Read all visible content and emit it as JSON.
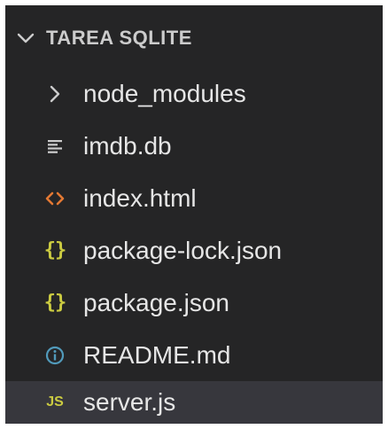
{
  "explorer": {
    "section_title": "TAREA SQLITE",
    "items": [
      {
        "label": "node_modules",
        "icon": "chevron-right-icon",
        "type": "folder",
        "collapsed": true
      },
      {
        "label": "imdb.db",
        "icon": "lines-icon",
        "type": "file"
      },
      {
        "label": "index.html",
        "icon": "html-icon",
        "type": "file"
      },
      {
        "label": "package-lock.json",
        "icon": "json-icon",
        "icon_text": "{}",
        "type": "file"
      },
      {
        "label": "package.json",
        "icon": "json-icon",
        "icon_text": "{}",
        "type": "file"
      },
      {
        "label": "README.md",
        "icon": "info-icon",
        "type": "file"
      },
      {
        "label": "server.js",
        "icon": "js-icon",
        "icon_text": "JS",
        "type": "file",
        "selected": true
      }
    ]
  },
  "colors": {
    "panel_background": "#252526",
    "selected_background": "#37373d",
    "text": "#cccccc",
    "html_icon": "#e37933",
    "json_icon": "#cbcb41",
    "js_icon": "#cbcb41",
    "info_icon": "#519aba"
  }
}
